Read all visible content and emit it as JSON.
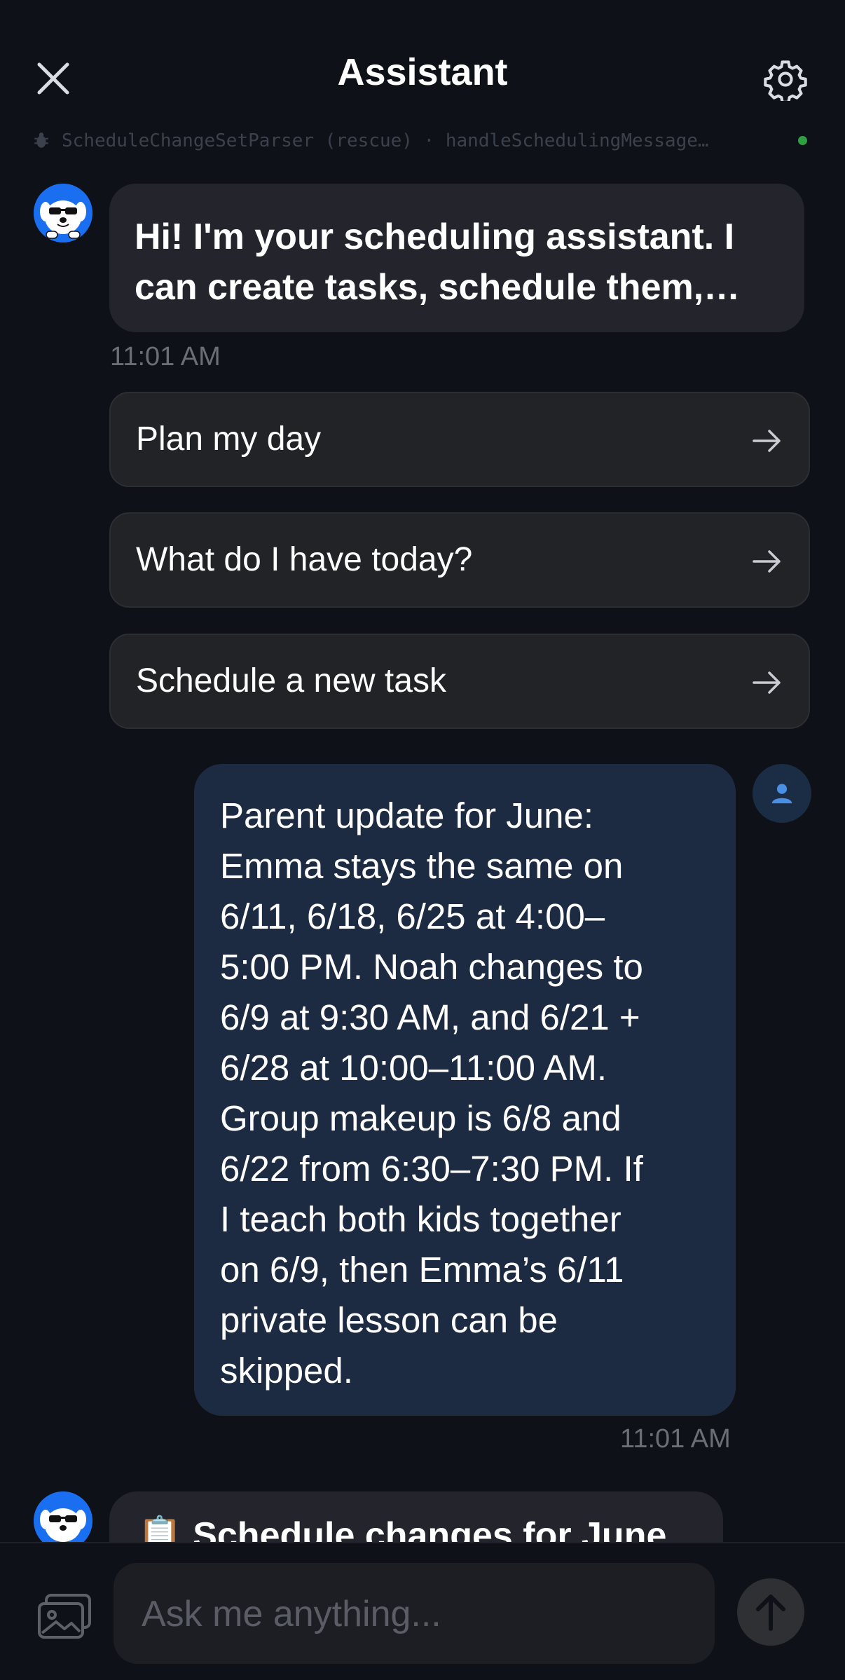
{
  "header": {
    "title": "Assistant",
    "close_icon": "close-icon",
    "settings_icon": "gear-icon",
    "debug_text": "ScheduleChangeSetParser (rescue) · handleSchedulingMessage…",
    "status_color": "#2ea043"
  },
  "messages": {
    "greeting": {
      "text": "Hi! I'm your scheduling assistant. I can create tasks, schedule them,…",
      "time": "11:01 AM"
    },
    "user": {
      "text": "Parent update for June:\nEmma stays the same on\n6/11, 6/18, 6/25 at 4:00–\n5:00 PM. Noah changes to\n6/9 at 9:30 AM, and 6/21 +\n6/28 at 10:00–11:00 AM.\nGroup makeup is 6/8 and\n6/22 from 6:30–7:30 PM. If\nI teach both kids together\non 6/9, then Emma’s 6/11\nprivate lesson can be\nskipped.",
      "time": "11:01 AM"
    },
    "reply": {
      "emoji": "📋",
      "text": "Schedule changes for June"
    }
  },
  "suggestions": [
    {
      "label": "Plan my day"
    },
    {
      "label": "What do I have today?"
    },
    {
      "label": "Schedule a new task"
    }
  ],
  "composer": {
    "placeholder": "Ask me anything..."
  },
  "colors": {
    "background": "#0e1117",
    "user_bubble": "#1d2b42",
    "bot_bubble": "#24252c",
    "accent": "#1a6ff0"
  }
}
